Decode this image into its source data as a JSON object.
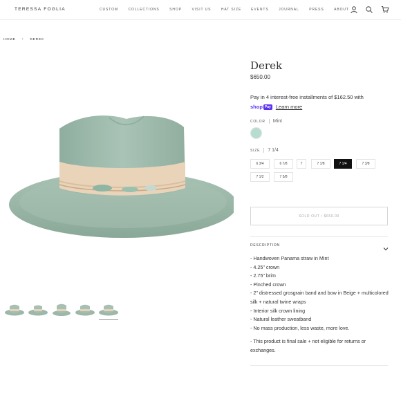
{
  "header": {
    "brand": "TERESSA FOGLIA",
    "nav": [
      "CUSTOM",
      "COLLECTIONS",
      "SHOP",
      "VISIT US",
      "HAT SIZE",
      "EVENTS",
      "JOURNAL",
      "PRESS",
      "ABOUT"
    ],
    "icons": [
      "account-icon",
      "search-icon",
      "cart-icon"
    ]
  },
  "breadcrumb": {
    "home": "HOME",
    "separator": "›",
    "current": "DEREK"
  },
  "product": {
    "title": "Derek",
    "price": "$650.00",
    "installments_text": "Pay in 4 interest-free installments of $162.50 with",
    "shoppay_shop": "shop",
    "shoppay_pay": "Pay",
    "learn_more": "Learn more",
    "color_label": "COLOR",
    "color_value": "Mint",
    "swatch_color": "#b9dcd0",
    "size_label": "SIZE",
    "size_value": "7 1/4",
    "sizes": [
      "6 3/4",
      "6 7/8",
      "7",
      "7 1/8",
      "7 1/4",
      "7 3/8",
      "7 1/2",
      "7 5/8"
    ],
    "selected_size": "7 1/4",
    "soldout_label": "SOLD OUT • $650.00",
    "description_label": "DESCRIPTION",
    "bullets": [
      "- Handwoven Panama straw in Mint",
      "- 4.25\" crown",
      "- 2.75\" brim",
      "- Pinched crown",
      "- 2\" distressed grosgrain band and bow in Beige + multicolored silk + natural twine wraps",
      "- Interior silk crown lining",
      "- Natural leather sweatband",
      "- No mass production, less waste, more love."
    ],
    "final_sale_note": "- This product is final sale + not eligible for returns or exchanges."
  },
  "thumbnails_count": 5,
  "colors": {
    "accent_shoppay": "#5a31f4",
    "selected_size_bg": "#111111",
    "hat_straw": "#a3bfb0",
    "hat_band": "#ead6bd"
  }
}
